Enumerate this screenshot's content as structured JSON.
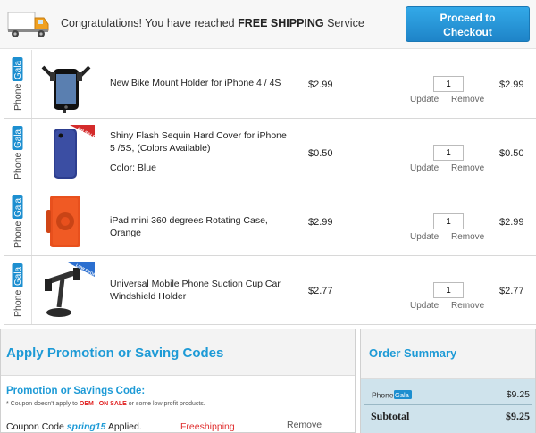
{
  "banner": {
    "prefix": "Congratulations! You have reached ",
    "highlight": "FREE SHIPPING",
    "suffix": " Service",
    "checkout_line1": "Proceed to",
    "checkout_line2": "Checkout"
  },
  "brand": {
    "phone": "Phone",
    "gala": "Gala"
  },
  "cart": {
    "update_label": "Update",
    "remove_label": "Remove",
    "items": [
      {
        "name": "New Bike Mount Holder for iPhone 4 / 4S",
        "color": "",
        "price": "$2.99",
        "qty": "1",
        "total": "$2.99",
        "thumb": "bike-mount-holder",
        "badge": ""
      },
      {
        "name": "Shiny Flash Sequin Hard Cover for iPhone 5 /5S, (Colors Available)",
        "color": "Color: Blue",
        "price": "$0.50",
        "qty": "1",
        "total": "$0.50",
        "thumb": "blue-sequin-case",
        "badge": "ON SALE"
      },
      {
        "name": "iPad mini 360 degrees Rotating Case, Orange",
        "color": "",
        "price": "$2.99",
        "qty": "1",
        "total": "$2.99",
        "thumb": "orange-rotating-case",
        "badge": ""
      },
      {
        "name": "Universal Mobile Phone Suction Cup Car Windshield Holder",
        "color": "",
        "price": "$2.77",
        "qty": "1",
        "total": "$2.77",
        "thumb": "suction-cup-holder",
        "badge": "LOW PROFIT"
      }
    ]
  },
  "promo": {
    "title": "Apply Promotion or Saving Codes",
    "subtitle": "Promotion or Savings Code:",
    "note_prefix": "* Coupon doesn't apply to ",
    "note_oem": "OEM",
    "note_sep": " , ",
    "note_sale": "ON SALE",
    "note_suffix": " or some low profit products.",
    "coupon_prefix": "Coupon Code ",
    "coupon_code": "spring15",
    "coupon_suffix": " Applied.",
    "coupon_type": "Freeshipping",
    "remove_label": "Remove"
  },
  "summary": {
    "title": "Order Summary",
    "brand_amount": "$9.25",
    "subtotal_label": "Subtotal",
    "subtotal_amount": "$9.25"
  },
  "colors": {
    "accent_blue": "#1d9ad6",
    "checkout_blue": "#1e84c8",
    "sale_red": "#e02020",
    "summary_bg": "#cfe3ec"
  }
}
